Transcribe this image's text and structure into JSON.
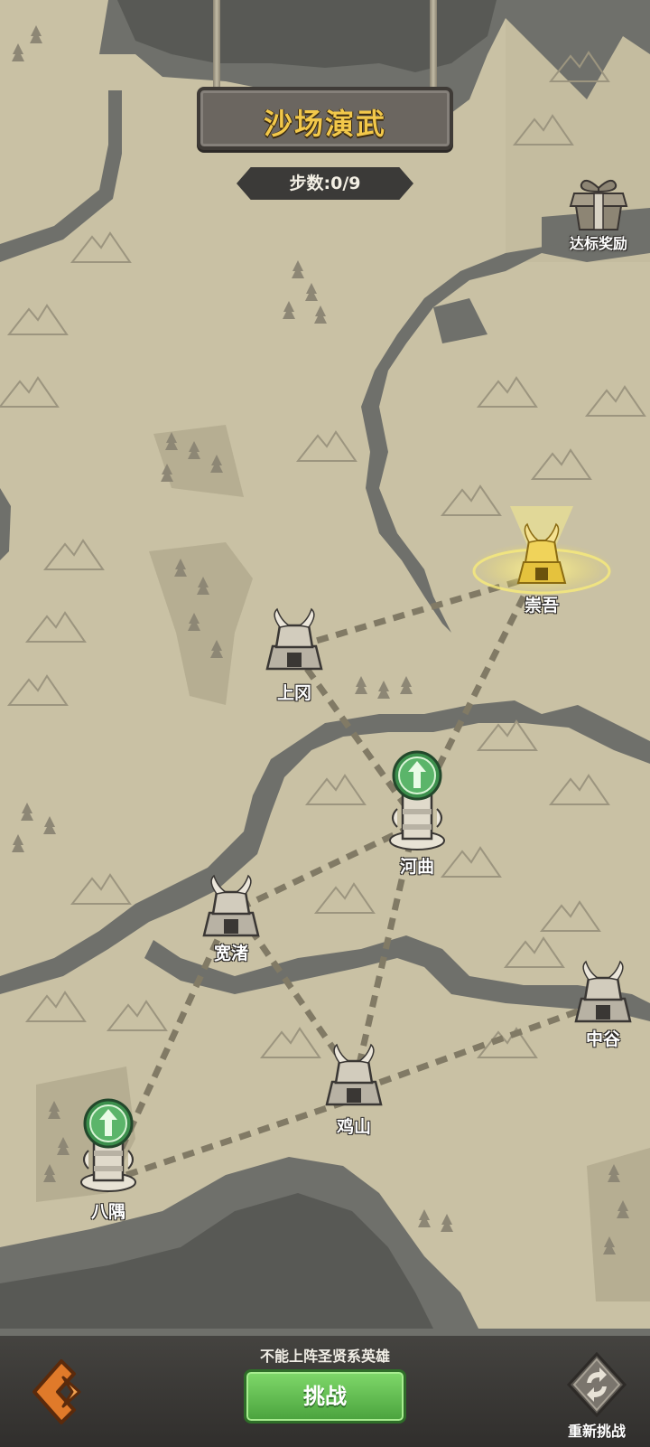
{
  "header": {
    "title": "沙场演武",
    "steps": "步数:0/9"
  },
  "reward": {
    "label": "达标奖励",
    "icon": "gift-box-icon"
  },
  "nodes": {
    "chongwu": "崇吾",
    "shanggang": "上冈",
    "hequ": "河曲",
    "kuanzhu": "宽渚",
    "zhonggu": "中谷",
    "jishan": "鸡山",
    "bayu": "八隅"
  },
  "footer": {
    "restriction": "不能上阵圣贤系英雄",
    "challenge": "挑战",
    "retry": "重新挑战",
    "back_icon": "back-arrow-icon",
    "retry_icon": "refresh-icon"
  },
  "colors": {
    "paper": "#c9c1a4",
    "water": "#6f706b",
    "gold": "#f2c84a",
    "green": "#4aa23d"
  }
}
